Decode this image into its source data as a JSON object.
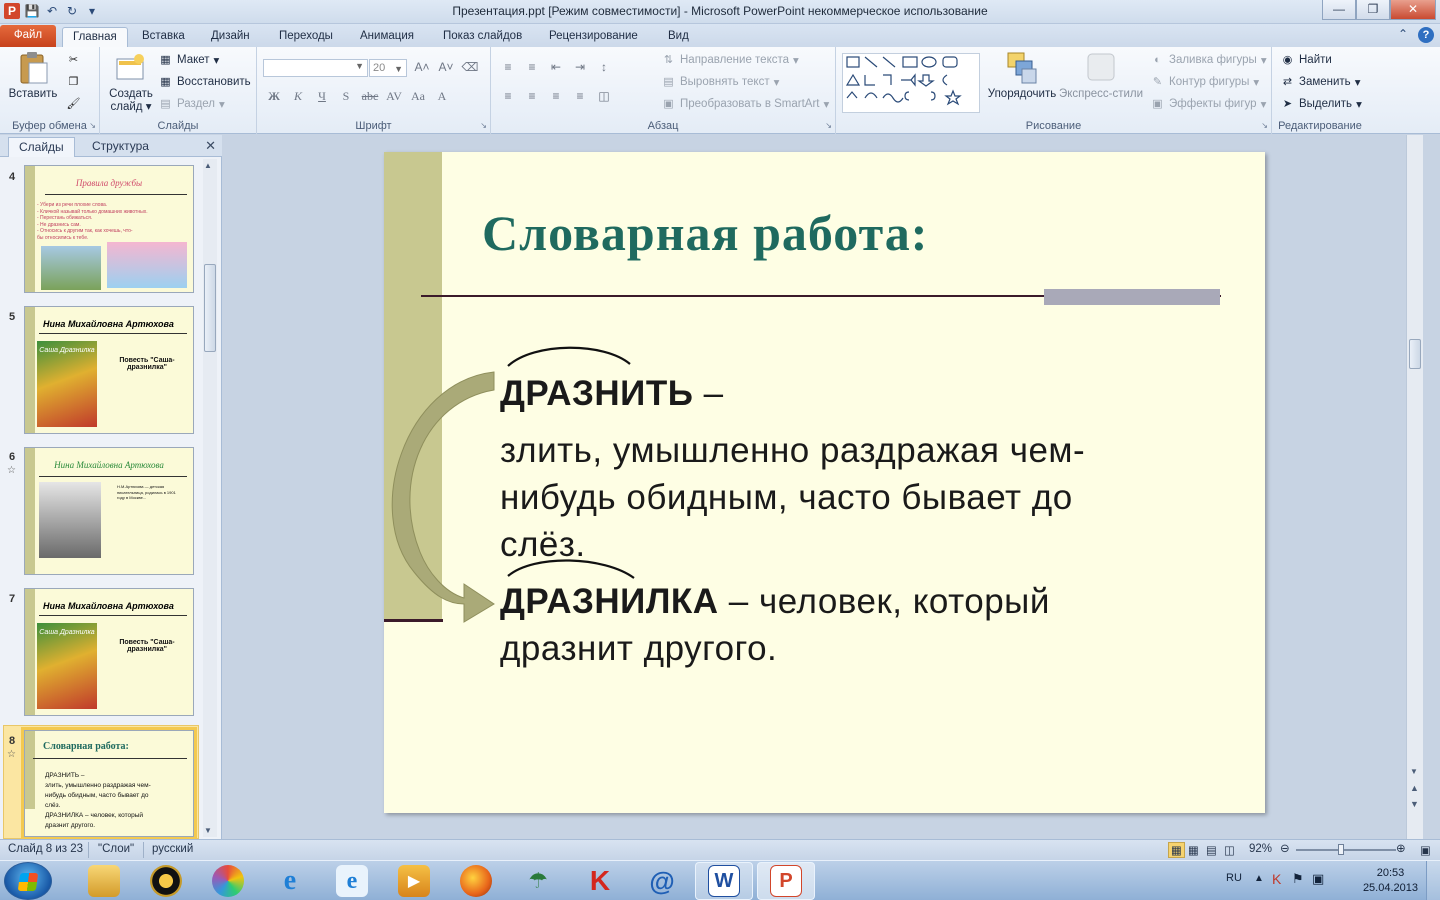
{
  "window": {
    "title": "Презентация.ppt [Режим совместимости]  -  Microsoft PowerPoint некоммерческое использование"
  },
  "tabs": [
    {
      "label": "Файл"
    },
    {
      "label": "Главная"
    },
    {
      "label": "Вставка"
    },
    {
      "label": "Дизайн"
    },
    {
      "label": "Переходы"
    },
    {
      "label": "Анимация"
    },
    {
      "label": "Показ слайдов"
    },
    {
      "label": "Рецензирование"
    },
    {
      "label": "Вид"
    }
  ],
  "ribbon": {
    "clipboard": {
      "label": "Буфер обмена",
      "paste": "Вставить"
    },
    "slides": {
      "label": "Слайды",
      "new_slide_1": "Создать",
      "new_slide_2": "слайд",
      "layout": "Макет",
      "reset": "Восстановить",
      "section": "Раздел"
    },
    "font": {
      "label": "Шрифт",
      "font_name": "",
      "font_size": "20"
    },
    "paragraph": {
      "label": "Абзац",
      "text_direction": "Направление текста",
      "align_text": "Выровнять текст",
      "smartart": "Преобразовать в SmartArt"
    },
    "drawing": {
      "label": "Рисование",
      "arrange": "Упорядочить",
      "quick_styles": "Экспресс-стили",
      "shape_fill": "Заливка фигуры",
      "shape_outline": "Контур фигуры",
      "shape_effects": "Эффекты фигур"
    },
    "editing": {
      "label": "Редактирование",
      "find": "Найти",
      "replace": "Заменить",
      "select": "Выделить"
    }
  },
  "left_pane": {
    "tabs": [
      "Слайды",
      "Структура"
    ],
    "thumbnails": [
      {
        "num": "4",
        "title": "Правила дружбы",
        "lines": [
          "- Убери из речи плохие слова.",
          "- Кличкой называй только домашних животных.",
          "- Перестань обижаться.",
          "- Не дразнись сам.",
          "- Относись к другим так, как хочешь, что-",
          "бы относились к тебе."
        ]
      },
      {
        "num": "5",
        "title": "Нина Михайловна Артюхова",
        "caption": "Повесть \"Саша-дразнилка\"",
        "book": "Саша Дразнилка"
      },
      {
        "num": "6",
        "title": "Нина Михайловна Артюхова",
        "text": "Н.М.Артюхова — детская писательница, родилась в 1901 году в Москве..."
      },
      {
        "num": "7",
        "title": "Нина Михайловна Артюхова",
        "caption": "Повесть \"Саша-дразнилка\"",
        "book": "Саша Дразнилка"
      },
      {
        "num": "8",
        "title": "Словарная работа:",
        "lines": [
          "ДРАЗНИТЬ –",
          "злить, умышленно раздражая чем-",
          "нибудь обидным, часто бывает до",
          "слёз.",
          "ДРАЗНИЛКА – человек, который",
          "дразнит другого."
        ]
      }
    ]
  },
  "slide": {
    "title": "Словарная работа:",
    "term1": "ДРАЗНИТЬ",
    "dash": " –",
    "def1_line1": "злить, умышленно раздражая чем-",
    "def1_line2": "нибудь обидным, часто бывает до",
    "def1_line3": "слёз.",
    "term2": "ДРАЗНИЛКА",
    "def2_line1": " – человек, который",
    "def2_line2": "дразнит другого.",
    "colors": {
      "title": "#1f6a5f",
      "background": "#fefee4",
      "stripe": "#c8c890"
    }
  },
  "status": {
    "slide_info": "Слайд 8 из 23",
    "theme": "\"Слои\"",
    "language": "русский",
    "zoom": "92%"
  },
  "taskbar": {
    "lang": "RU",
    "time": "20:53",
    "date": "25.04.2013"
  }
}
